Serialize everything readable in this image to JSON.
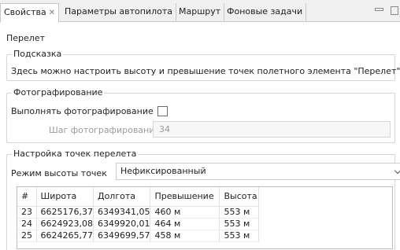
{
  "tabs": [
    {
      "label": "Свойства",
      "active": true,
      "close": "✕"
    },
    {
      "label": "Параметры автопилота"
    },
    {
      "label": "Маршрут"
    },
    {
      "label": "Фоновые задачи"
    }
  ],
  "section_title": "Перелет",
  "hint": {
    "legend": "Подсказка",
    "text": "Здесь можно настроить высоту и превышение точек полетного элемента \"Перелет\"."
  },
  "photo": {
    "legend": "Фотографирование",
    "enable_label": "Выполнять фотографирование",
    "enabled": false,
    "step_label": "Шаг фотографирования",
    "step_value": "34"
  },
  "points": {
    "legend": "Настройка точек перелета",
    "mode_label": "Режим высоты точек",
    "mode_value": "Нефиксированный",
    "columns": [
      "#",
      "Широта",
      "Долгота",
      "Превышение",
      "Высота"
    ],
    "rows": [
      [
        "23",
        "6625176,37",
        "6349341,05",
        "460 м",
        "553 м"
      ],
      [
        "24",
        "6624923,08",
        "6349920,01",
        "464 м",
        "553 м"
      ],
      [
        "25",
        "6624265,77",
        "6349699,57",
        "458 м",
        "553 м"
      ]
    ]
  },
  "icons": {
    "minimize": "minimize-icon",
    "maximize": "maximize-icon",
    "dropdown": "chevron-down-icon"
  }
}
